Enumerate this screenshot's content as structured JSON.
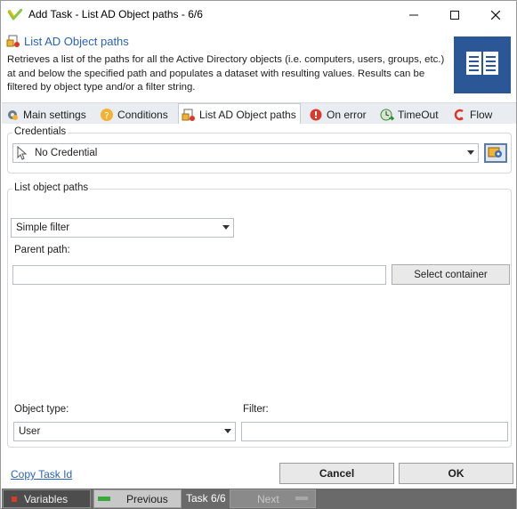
{
  "window": {
    "title": "Add Task - List AD Object paths - 6/6",
    "minimize_glyph": "—",
    "maximize_glyph": "☐",
    "close_glyph": "✕"
  },
  "header": {
    "title": "List AD Object paths",
    "description": "Retrieves a list of the paths for all the Active Directory objects (i.e. computers, users, groups, etc.) at and below the specified path and populates a dataset with resulting values. Results can be filtered by object type and/or a filter string.",
    "tile_icon": "book-icon",
    "tile_color": "#2b5797"
  },
  "tabs": [
    {
      "label": "Main settings",
      "icon": "gear-icon",
      "active": false
    },
    {
      "label": "Conditions",
      "icon": "question-icon",
      "active": false
    },
    {
      "label": "List AD Object paths",
      "icon": "ad-object-icon",
      "active": true
    },
    {
      "label": "On error",
      "icon": "error-icon",
      "active": false
    },
    {
      "label": "TimeOut",
      "icon": "timeout-icon",
      "active": false
    },
    {
      "label": "Flow",
      "icon": "flow-icon",
      "active": false
    }
  ],
  "credentials": {
    "group_label": "Credentials",
    "selected": "No Credential",
    "edit_icon": "credential-edit-icon"
  },
  "list_paths": {
    "group_label": "List object paths",
    "filter_mode": "Simple filter",
    "parent_path_label": "Parent path:",
    "parent_path_value": "",
    "select_container_label": "Select container",
    "object_type_label": "Object type:",
    "object_type_value": "User",
    "filter_label": "Filter:",
    "filter_value": ""
  },
  "footer": {
    "copy_task_id": "Copy Task Id",
    "cancel": "Cancel",
    "ok": "OK"
  },
  "statusbar": {
    "variables": "Variables",
    "previous": "Previous",
    "task_counter": "Task 6/6",
    "next": "Next"
  },
  "colors": {
    "accent_blue": "#2a64b5",
    "statusbar_bg": "#6a6a6a"
  }
}
